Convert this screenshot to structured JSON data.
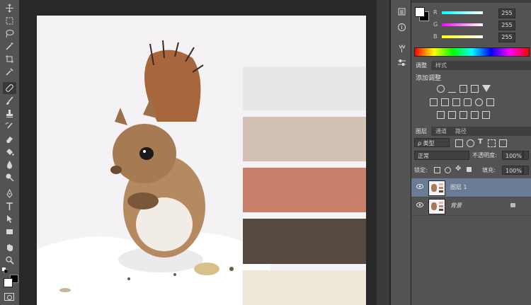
{
  "toolbar": {
    "tools": [
      "move-tool",
      "marquee-tool",
      "lasso-tool",
      "magic-wand-tool",
      "crop-tool",
      "eyedropper-tool",
      "healing-brush-tool",
      "brush-tool",
      "clone-stamp-tool",
      "history-brush-tool",
      "eraser-tool",
      "paint-bucket-tool",
      "blur-tool",
      "dodge-tool",
      "pen-tool",
      "type-tool",
      "path-selection-tool",
      "rectangle-tool",
      "hand-tool",
      "zoom-tool"
    ],
    "active_tool": "healing-brush-tool",
    "foreground_color": "#ffffff",
    "background_color": "#000000"
  },
  "document": {
    "palette_colors": [
      "#e8e6e8",
      "#d3c2b3",
      "#c8806a",
      "#56493f",
      "#efe8d8"
    ]
  },
  "color_panel": {
    "sliders": [
      {
        "label": "R",
        "value": "255",
        "gradient": "linear-gradient(90deg,#00ffff,#ffffff)"
      },
      {
        "label": "G",
        "value": "255",
        "gradient": "linear-gradient(90deg,#ff00ff,#ffffff)"
      },
      {
        "label": "B",
        "value": "255",
        "gradient": "linear-gradient(90deg,#ffff00,#ffffff)"
      }
    ]
  },
  "adjustments_panel": {
    "tabs": [
      "调整",
      "样式"
    ],
    "title": "添加调整"
  },
  "layers_panel": {
    "tabs": [
      "图层",
      "通道",
      "路径"
    ],
    "filter_label": "ρ 类型",
    "blend_mode": "正常",
    "opacity_label": "不透明度:",
    "opacity_value": "100%",
    "lock_label": "锁定:",
    "fill_label": "填充:",
    "fill_value": "100%",
    "layers": [
      {
        "name": "图层 1",
        "selected": true
      },
      {
        "name": "背景",
        "selected": false
      }
    ]
  }
}
